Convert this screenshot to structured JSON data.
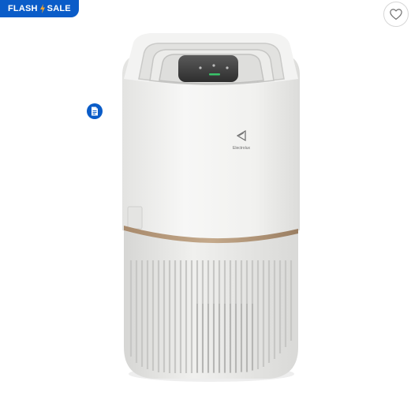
{
  "badge": {
    "text_left": "FLASH",
    "text_right": "SALE",
    "icon": "lightning-bolt-icon",
    "color": "#0a5cc8"
  },
  "favorite": {
    "icon": "heart-outline-icon"
  },
  "document": {
    "icon": "document-icon"
  },
  "product": {
    "brand_label": "Electrolux",
    "accent_band_color": "#b59a7c",
    "body_color": "#f1f1ef"
  }
}
